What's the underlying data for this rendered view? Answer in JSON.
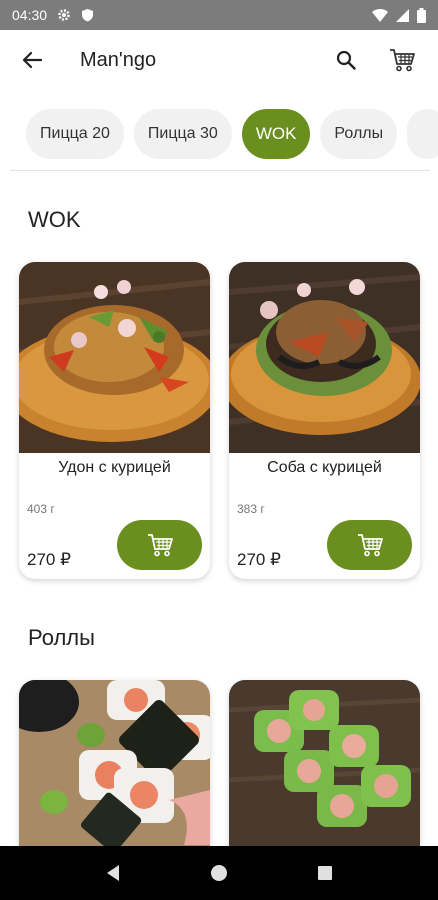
{
  "status_bar": {
    "time": "04:30"
  },
  "app_bar": {
    "title": "Man'ngo"
  },
  "tabs": [
    {
      "label": "Пицца 20",
      "active": false
    },
    {
      "label": "Пицца 30",
      "active": false
    },
    {
      "label": "WOK",
      "active": true
    },
    {
      "label": "Роллы",
      "active": false
    }
  ],
  "sections": {
    "wok": {
      "title": "WOK",
      "items": [
        {
          "name": "Удон с курицей",
          "weight": "403 г",
          "price": "270 ₽"
        },
        {
          "name": "Соба с курицей",
          "weight": "383 г",
          "price": "270 ₽"
        }
      ]
    },
    "rolls": {
      "title": "Роллы"
    }
  },
  "colors": {
    "accent": "#6a8f1f",
    "status_bar": "#7c7c7c",
    "tab_bg": "#f1f1f1"
  },
  "icons": [
    "back-arrow-icon",
    "search-icon",
    "shopping-cart-icon",
    "cart-add-icon"
  ]
}
